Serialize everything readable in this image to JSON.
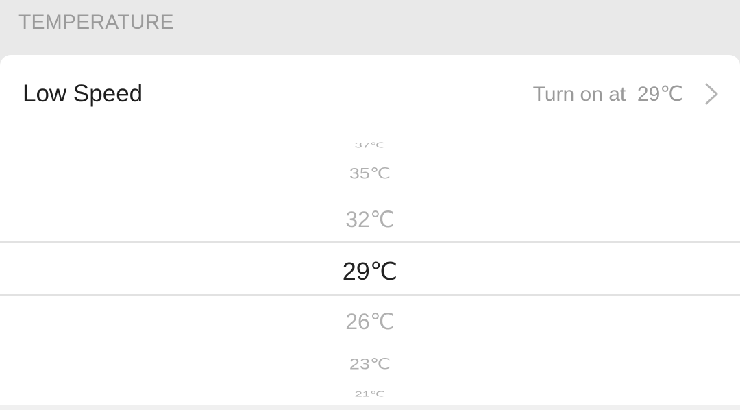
{
  "section": {
    "title": "TEMPERATURE"
  },
  "setting_row": {
    "label": "Low Speed",
    "value": "Turn on at  29℃",
    "chevron_icon": "chevron-right-icon"
  },
  "picker": {
    "options": [
      "37℃",
      "35℃",
      "32℃",
      "29℃",
      "26℃",
      "23℃",
      "21℃"
    ],
    "selected": "29℃"
  },
  "colors": {
    "background": "#e9e9e9",
    "card": "#ffffff",
    "muted_text": "#9a9a9a",
    "primary_text": "#1e1e1e"
  }
}
